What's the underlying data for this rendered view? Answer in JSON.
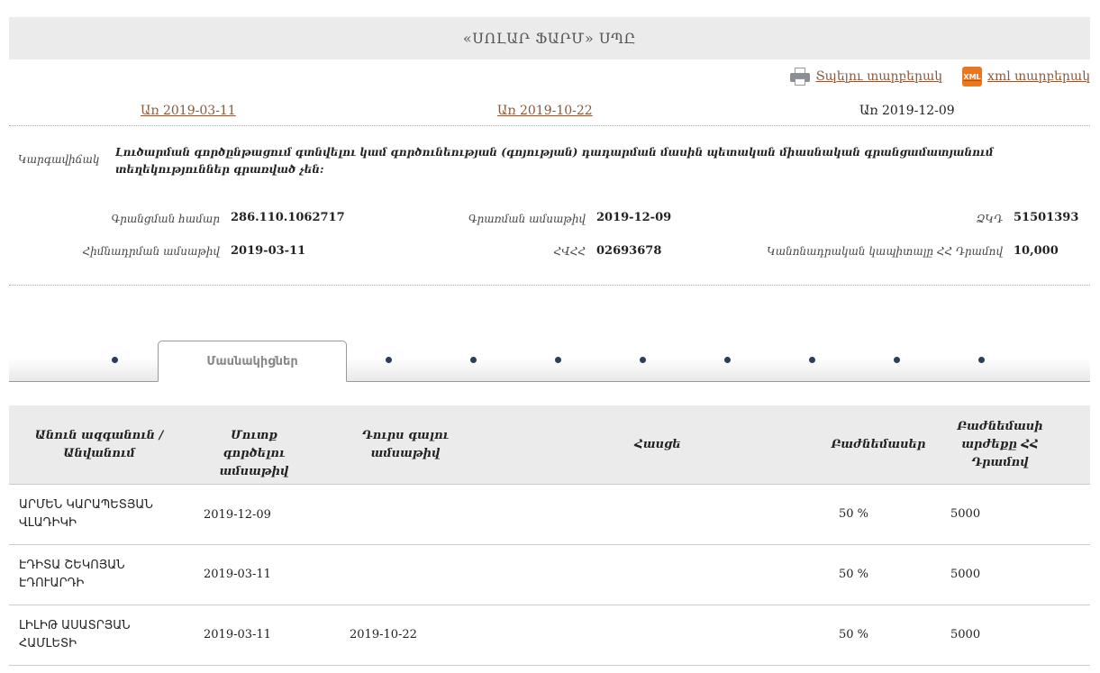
{
  "header": {
    "title": "«ՍՈԼԱՐ ՖԱՐՄ» ՍՊԸ"
  },
  "downloads": {
    "print_label": "Տպելու տարբերակ",
    "xml_label": "xml տարբերակ",
    "xml_icon_text": "XML",
    "print_icon": "printer-icon",
    "xml_icon": "xml-file-icon"
  },
  "dates": {
    "first": "Առ 2019-03-11",
    "second": "Առ 2019-10-22",
    "current": "Առ 2019-12-09"
  },
  "status": {
    "label": "Կարգավիճակ",
    "value": "Լուծարման գործընթացում գտնվելու կամ գործունեության (գոյության) դադարման մասին պետական միասնական գրանցամատյանում տեղեկություններ գրառված չեն:"
  },
  "info": {
    "reg_number_label": "Գրանցման համար",
    "reg_number": "286.110.1062717",
    "entry_date_label": "Գրառման ամսաթիվ",
    "entry_date": "2019-12-09",
    "zkd_label": "ՁԿԴ",
    "zkd": "51501393",
    "founding_date_label": "Հիմնադրման ամսաթիվ",
    "founding_date": "2019-03-11",
    "tin_label": "ՀՎՀՀ",
    "tin": "02693678",
    "capital_label": "Կանոնադրական կապիտալը ՀՀ Դրամով",
    "capital": "10,000"
  },
  "tabs": {
    "active_label": "Մասնակիցներ"
  },
  "table": {
    "headers": {
      "name": "Անուն ազգանուն / Անվանում",
      "entry": "Մուտք գործելու ամսաթիվ",
      "exit": "Դուրս գալու ամսաթիվ",
      "address": "Հասցե",
      "shares": "Բաժնեմասեր",
      "share_value": "Բաժնեմասի արժեքը ՀՀ Դրամով"
    },
    "rows": [
      {
        "name": "ԱՐՄԵՆ ԿԱՐԱՊԵՏՅԱՆ ՎԼԱԴԻԿԻ",
        "entry": "2019-12-09",
        "exit": "",
        "address": "",
        "shares": "50 %",
        "value": "5000"
      },
      {
        "name": "ԷԴԻՏԱ ՇԵԿՈՅԱՆ ԷԴՈՒԱՐԴԻ",
        "entry": "2019-03-11",
        "exit": "",
        "address": "",
        "shares": "50 %",
        "value": "5000"
      },
      {
        "name": "ԼԻԼԻԹ ԱՍԱՏՐՅԱՆ ՀԱՄԼԵՏԻ",
        "entry": "2019-03-11",
        "exit": "2019-10-22",
        "address": "",
        "shares": "50 %",
        "value": "5000"
      }
    ]
  }
}
